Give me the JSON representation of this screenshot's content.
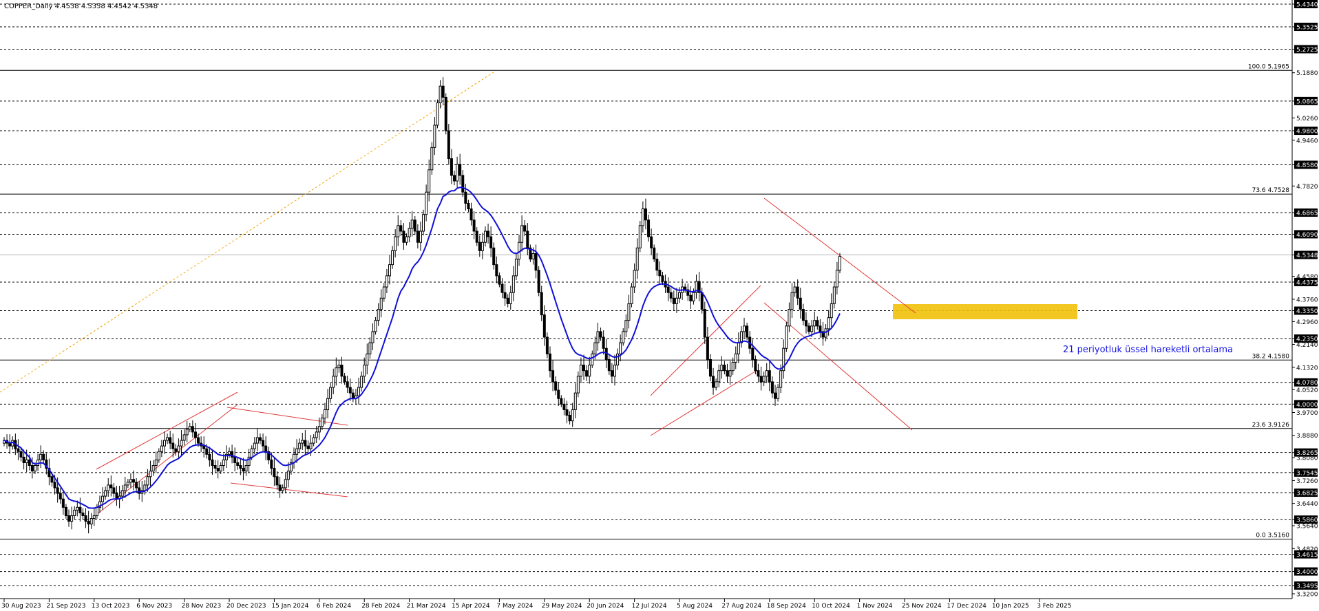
{
  "header": {
    "symbol_line": "COPPER_Daily  4.4538 4.5358 4.4542 4.5348"
  },
  "annotation": {
    "ema_note": "21 periyotluk üssel hareketli ortalama"
  },
  "colors": {
    "candle": "#000000",
    "ema": "#1010d8",
    "channel": "#e03a3a",
    "zone": "#f2c10a",
    "fib_line": "#000000",
    "fib_diagonal": "#f2a50a",
    "hline": "#000000"
  },
  "chart_data": {
    "type": "candlestick",
    "ylim": [
      3.32,
      5.434
    ],
    "y_ticks": [
      "5.4340",
      "5.3525",
      "5.2725",
      "5.1880",
      "5.0865",
      "5.0260",
      "4.9800",
      "4.9460",
      "4.8580",
      "4.7820",
      "4.6865",
      "4.6090",
      "4.5348",
      "4.4580",
      "4.4375",
      "4.3760",
      "4.3350",
      "4.2960",
      "4.2350",
      "4.2140",
      "4.1320",
      "4.0780",
      "4.0520",
      "4.0000",
      "3.9700",
      "3.8880",
      "3.8265",
      "3.8080",
      "3.7545",
      "3.7260",
      "3.6825",
      "3.6440",
      "3.5860",
      "3.5640",
      "3.4820",
      "3.4615",
      "3.4000",
      "3.3495",
      "3.3200"
    ],
    "highlighted_levels": [
      "5.4340",
      "5.3525",
      "5.2725",
      "5.0865",
      "4.9800",
      "4.8580",
      "4.6865",
      "4.6090",
      "4.5348",
      "4.4375",
      "4.3350",
      "4.2350",
      "4.0780",
      "4.0000",
      "3.8265",
      "3.7545",
      "3.6825",
      "3.5860",
      "3.4615",
      "3.4000",
      "3.3495"
    ],
    "dashed_levels": [
      5.434,
      5.3525,
      5.2725,
      5.0865,
      4.98,
      4.858,
      4.6865,
      4.609,
      4.4375,
      4.335,
      4.235,
      4.078,
      4.0,
      3.8265,
      3.7545,
      3.6825,
      3.586,
      3.4615,
      3.4,
      3.3495
    ],
    "current_price": 4.5348,
    "fibonacci": [
      {
        "label": "100.0 5.1965",
        "value": 5.1965
      },
      {
        "label": "73.6 4.7528",
        "value": 4.7528
      },
      {
        "label": "38.2 4.1580",
        "value": 4.158
      },
      {
        "label": "23.6 3.9126",
        "value": 3.9126
      },
      {
        "label": "0.0 3.5160",
        "value": 3.516
      }
    ],
    "x_labels": [
      "30 Aug 2023",
      "21 Sep 2023",
      "13 Oct 2023",
      "6 Nov 2023",
      "28 Nov 2023",
      "20 Dec 2023",
      "15 Jan 2024",
      "6 Feb 2024",
      "28 Feb 2024",
      "21 Mar 2024",
      "15 Apr 2024",
      "7 May 2024",
      "29 May 2024",
      "20 Jun 2024",
      "12 Jul 2024",
      "5 Aug 2024",
      "27 Aug 2024",
      "18 Sep 2024",
      "10 Oct 2024",
      "1 Nov 2024",
      "25 Nov 2024",
      "17 Dec 2024",
      "10 Jan 2025",
      "3 Feb 2025"
    ],
    "bars_per_label": 16,
    "closes": [
      3.87,
      3.86,
      3.85,
      3.87,
      3.84,
      3.83,
      3.81,
      3.79,
      3.8,
      3.78,
      3.76,
      3.78,
      3.8,
      3.82,
      3.8,
      3.77,
      3.74,
      3.72,
      3.7,
      3.68,
      3.66,
      3.63,
      3.6,
      3.58,
      3.6,
      3.62,
      3.63,
      3.61,
      3.6,
      3.58,
      3.57,
      3.59,
      3.6,
      3.63,
      3.65,
      3.67,
      3.69,
      3.71,
      3.7,
      3.68,
      3.66,
      3.67,
      3.69,
      3.71,
      3.72,
      3.73,
      3.72,
      3.7,
      3.68,
      3.69,
      3.71,
      3.74,
      3.76,
      3.78,
      3.8,
      3.83,
      3.85,
      3.87,
      3.88,
      3.86,
      3.84,
      3.83,
      3.85,
      3.87,
      3.89,
      3.91,
      3.92,
      3.9,
      3.88,
      3.86,
      3.85,
      3.84,
      3.82,
      3.8,
      3.78,
      3.77,
      3.76,
      3.78,
      3.8,
      3.82,
      3.83,
      3.81,
      3.79,
      3.78,
      3.77,
      3.76,
      3.78,
      3.81,
      3.84,
      3.86,
      3.88,
      3.87,
      3.85,
      3.83,
      3.8,
      3.77,
      3.74,
      3.71,
      3.69,
      3.7,
      3.73,
      3.76,
      3.79,
      3.82,
      3.84,
      3.86,
      3.87,
      3.85,
      3.84,
      3.86,
      3.88,
      3.9,
      3.92,
      3.95,
      3.98,
      4.02,
      4.06,
      4.1,
      4.13,
      4.14,
      4.1,
      4.08,
      4.06,
      4.04,
      4.02,
      4.03,
      4.06,
      4.1,
      4.14,
      4.18,
      4.22,
      4.26,
      4.3,
      4.34,
      4.38,
      4.42,
      4.46,
      4.5,
      4.55,
      4.6,
      4.64,
      4.62,
      4.58,
      4.6,
      4.63,
      4.66,
      4.62,
      4.58,
      4.62,
      4.68,
      4.76,
      4.84,
      4.92,
      5.0,
      5.08,
      5.14,
      5.1,
      4.98,
      4.88,
      4.82,
      4.8,
      4.86,
      4.82,
      4.76,
      4.72,
      4.7,
      4.66,
      4.62,
      4.58,
      4.55,
      4.58,
      4.62,
      4.6,
      4.56,
      4.5,
      4.46,
      4.43,
      4.4,
      4.38,
      4.36,
      4.4,
      4.46,
      4.52,
      4.58,
      4.64,
      4.62,
      4.56,
      4.52,
      4.54,
      4.48,
      4.4,
      4.32,
      4.24,
      4.18,
      4.12,
      4.08,
      4.05,
      4.02,
      4.0,
      3.98,
      3.96,
      3.94,
      3.98,
      4.04,
      4.1,
      4.14,
      4.12,
      4.1,
      4.14,
      4.18,
      4.22,
      4.26,
      4.24,
      4.2,
      4.16,
      4.12,
      4.1,
      4.14,
      4.18,
      4.22,
      4.26,
      4.3,
      4.36,
      4.42,
      4.48,
      4.56,
      4.64,
      4.7,
      4.66,
      4.6,
      4.56,
      4.52,
      4.48,
      4.46,
      4.44,
      4.42,
      4.4,
      4.38,
      4.36,
      4.38,
      4.4,
      4.42,
      4.41,
      4.39,
      4.37,
      4.4,
      4.44,
      4.4,
      4.34,
      4.24,
      4.16,
      4.1,
      4.06,
      4.08,
      4.12,
      4.14,
      4.12,
      4.1,
      4.12,
      4.15,
      4.18,
      4.22,
      4.26,
      4.28,
      4.24,
      4.2,
      4.16,
      4.12,
      4.1,
      4.08,
      4.1,
      4.12,
      4.08,
      4.04,
      4.02,
      4.06,
      4.12,
      4.2,
      4.28,
      4.34,
      4.4,
      4.42,
      4.38,
      4.34,
      4.3,
      4.28,
      4.26,
      4.28,
      4.3,
      4.28,
      4.26,
      4.24,
      4.27,
      4.31,
      4.36,
      4.42,
      4.48,
      4.53
    ],
    "ema": [
      3.87,
      3.866,
      3.861,
      3.863,
      3.857,
      3.85,
      3.843,
      3.83,
      3.82,
      3.81,
      3.79,
      3.785,
      3.787,
      3.79,
      3.788,
      3.777,
      3.765,
      3.75,
      3.735,
      3.72,
      3.705,
      3.69,
      3.675,
      3.66,
      3.655,
      3.652,
      3.65,
      3.645,
      3.64,
      3.635,
      3.628,
      3.627,
      3.627,
      3.63,
      3.635,
      3.64,
      3.645,
      3.653,
      3.658,
      3.66,
      3.66,
      3.661,
      3.664,
      3.669,
      3.675,
      3.681,
      3.685,
      3.686,
      3.686,
      3.686,
      3.688,
      3.694,
      3.703,
      3.713,
      3.725,
      3.738,
      3.753,
      3.767,
      3.781,
      3.79,
      3.795,
      3.8,
      3.805,
      3.815,
      3.825,
      3.835,
      3.845,
      3.85,
      3.853,
      3.854,
      3.854,
      3.853,
      3.848,
      3.843,
      3.835,
      3.828,
      3.82,
      3.817,
      3.815,
      3.815,
      3.816,
      3.815,
      3.812,
      3.809,
      3.805,
      3.8,
      3.799,
      3.802,
      3.808,
      3.815,
      3.822,
      3.827,
      3.829,
      3.829,
      3.826,
      3.818,
      3.809,
      3.799,
      3.79,
      3.782,
      3.78,
      3.782,
      3.785,
      3.79,
      3.797,
      3.805,
      3.813,
      3.818,
      3.822,
      3.828,
      3.835,
      3.844,
      3.853,
      3.866,
      3.88,
      3.9,
      3.92,
      3.945,
      3.97,
      3.99,
      4.0,
      4.01,
      4.015,
      4.02,
      4.02,
      4.02,
      4.025,
      4.035,
      4.05,
      4.065,
      4.085,
      4.105,
      4.13,
      4.16,
      4.19,
      4.22,
      4.25,
      4.28,
      4.31,
      4.345,
      4.38,
      4.405,
      4.42,
      4.44,
      4.46,
      4.485,
      4.5,
      4.51,
      4.525,
      4.545,
      4.57,
      4.6,
      4.63,
      4.665,
      4.7,
      4.72,
      4.745,
      4.75,
      4.76,
      4.765,
      4.765,
      4.774,
      4.777,
      4.776,
      4.772,
      4.767,
      4.758,
      4.746,
      4.732,
      4.716,
      4.703,
      4.696,
      4.688,
      4.677,
      4.662,
      4.645,
      4.627,
      4.607,
      4.587,
      4.566,
      4.55,
      4.542,
      4.54,
      4.545,
      4.553,
      4.559,
      4.558,
      4.554,
      4.553,
      4.547,
      4.534,
      4.514,
      4.488,
      4.461,
      4.431,
      4.399,
      4.367,
      4.336,
      4.305,
      4.277,
      4.249,
      4.222,
      4.2,
      4.185,
      4.178,
      4.175,
      4.17,
      4.165,
      4.163,
      4.166,
      4.171,
      4.179,
      4.184,
      4.186,
      4.183,
      4.178,
      4.171,
      4.168,
      4.17,
      4.175,
      4.183,
      4.194,
      4.212,
      4.231,
      4.255,
      4.284,
      4.317,
      4.352,
      4.378,
      4.398,
      4.412,
      4.421,
      4.426,
      4.43,
      4.431,
      4.43,
      4.427,
      4.422,
      4.415,
      4.41,
      4.408,
      4.409,
      4.409,
      4.407,
      4.403,
      4.403,
      4.407,
      4.406,
      4.4,
      4.386,
      4.366,
      4.342,
      4.317,
      4.297,
      4.281,
      4.268,
      4.255,
      4.241,
      4.231,
      4.223,
      4.22,
      4.22,
      4.223,
      4.226,
      4.224,
      4.219,
      4.21,
      4.199,
      4.188,
      4.177,
      4.169,
      4.164,
      4.155,
      4.144,
      4.132,
      4.126,
      4.126,
      4.133,
      4.146,
      4.162,
      4.183,
      4.204,
      4.219,
      4.23,
      4.236,
      4.241,
      4.244,
      4.248,
      4.253,
      4.256,
      4.258,
      4.256,
      4.258,
      4.263,
      4.272,
      4.286,
      4.304,
      4.325
    ]
  }
}
